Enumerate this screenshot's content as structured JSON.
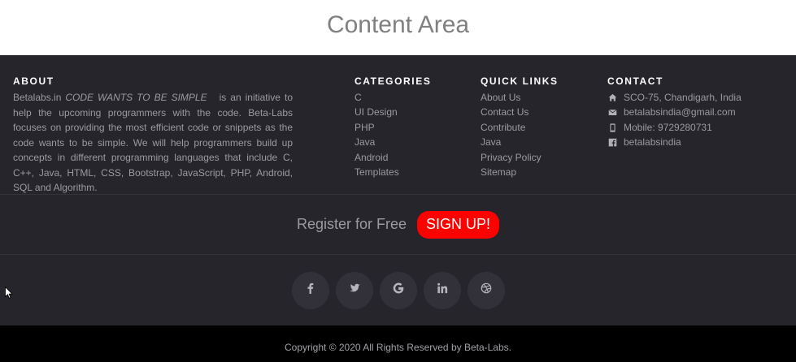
{
  "content_area": {
    "title": "Content Area"
  },
  "about": {
    "heading": "ABOUT",
    "brand": "Betalabs.in",
    "tagline": "CODE WANTS TO BE SIMPLE",
    "text": "is an initiative to help the upcoming programmers with the code. Beta-Labs focuses on providing the most efficient code or snippets as the code wants to be simple. We will help programmers build up concepts in different programming languages that include C, C++, Java, HTML, CSS, Bootstrap, JavaScript, PHP, Android, SQL and Algorithm."
  },
  "categories": {
    "heading": "CATEGORIES",
    "items": [
      "C",
      "UI Design",
      "PHP",
      "Java",
      "Android",
      "Templates"
    ]
  },
  "quick_links": {
    "heading": "QUICK LINKS",
    "items": [
      "About Us",
      "Contact Us",
      "Contribute",
      "Java",
      "Privacy Policy",
      "Sitemap"
    ]
  },
  "contact": {
    "heading": "CONTACT",
    "items": [
      {
        "icon": "home-icon",
        "text": "SCO-75, Chandigarh, India"
      },
      {
        "icon": "envelope-icon",
        "text": "betalabsindia@gmail.com"
      },
      {
        "icon": "mobile-icon",
        "text": "Mobile: 9729280731"
      },
      {
        "icon": "facebook-square-icon",
        "text": "betalabsindia"
      }
    ]
  },
  "register": {
    "text": "Register for Free",
    "button": "SIGN UP!"
  },
  "social": [
    "facebook-icon",
    "twitter-icon",
    "google-icon",
    "linkedin-icon",
    "dribbble-icon"
  ],
  "copyright": "Copyright © 2020 All Rights Reserved by Beta-Labs.",
  "colors": {
    "footer_bg": "#26252b",
    "accent": "#fe0000",
    "copyright_bg": "#000000"
  }
}
